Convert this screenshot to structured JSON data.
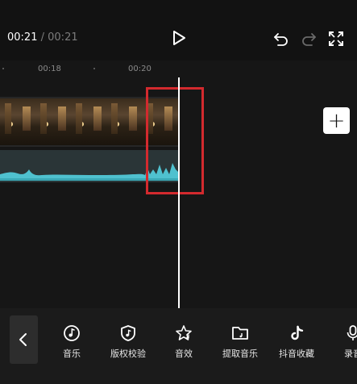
{
  "header": {
    "current_time": "00:21",
    "separator": "/",
    "total_time": "00:21"
  },
  "ruler": {
    "ticks": [
      "00:18",
      "00:20"
    ]
  },
  "toolbar": {
    "items": [
      {
        "label": "音乐",
        "icon": "music-icon"
      },
      {
        "label": "版权校验",
        "icon": "shield-music-icon"
      },
      {
        "label": "音效",
        "icon": "star-music-icon"
      },
      {
        "label": "提取音乐",
        "icon": "folder-icon"
      },
      {
        "label": "抖音收藏",
        "icon": "tiktok-icon"
      },
      {
        "label": "录音",
        "icon": "microphone-icon"
      }
    ]
  },
  "colors": {
    "highlight": "#d32a2e",
    "waveform": "#4fc1cf",
    "background": "#161616"
  }
}
